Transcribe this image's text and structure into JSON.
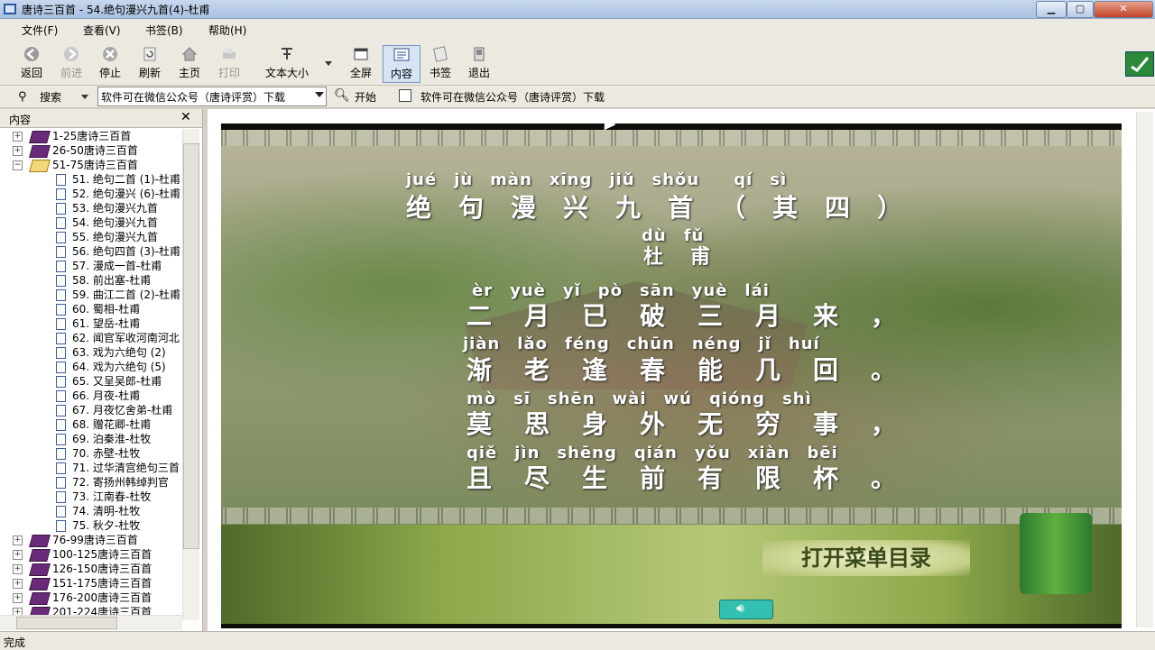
{
  "window": {
    "title": "唐诗三百首 - 54.绝句漫兴九首(4)-杜甫",
    "min_icon": "minimize-icon",
    "max_icon": "maximize-icon",
    "close_icon": "close-icon"
  },
  "menu": [
    "文件(F)",
    "查看(V)",
    "书签(B)",
    "帮助(H)"
  ],
  "toolbar": {
    "back": "返回",
    "forward": "前进",
    "stop": "停止",
    "refresh": "刷新",
    "home": "主页",
    "print": "打印",
    "textsize": "文本大小",
    "fullscreen": "全屏",
    "contents": "内容",
    "bookmark": "书签",
    "exit": "退出"
  },
  "search": {
    "label": "搜索",
    "value": "软件可在微信公众号（唐诗评赏）下载",
    "go": "开始",
    "result": "软件可在微信公众号（唐诗评赏）下载"
  },
  "sidebar": {
    "title": "内容",
    "close": "✕",
    "groups_top": [
      "1-25唐诗三百首",
      "26-50唐诗三百首",
      "51-75唐诗三百首"
    ],
    "leaves": [
      "51. 绝句二首 (1)-杜甫",
      "52. 绝句漫兴 (6)-杜甫",
      "53. 绝句漫兴九首",
      "54. 绝句漫兴九首",
      "55. 绝句漫兴九首",
      "56. 绝句四首 (3)-杜甫",
      "57. 漫成一首-杜甫",
      "58. 前出塞-杜甫",
      "59. 曲江二首 (2)-杜甫",
      "60. 蜀相-杜甫",
      "61. 望岳-杜甫",
      "62. 闻官军收河南河北",
      "63. 戏为六绝句 (2)",
      "64. 戏为六绝句 (5)",
      "65. 又呈吴郎-杜甫",
      "66. 月夜-杜甫",
      "67. 月夜忆舍弟-杜甫",
      "68. 赠花卿-杜甫",
      "69. 泊秦淮-杜牧",
      "70. 赤壁-杜牧",
      "71. 过华清宫绝句三首",
      "72. 寄扬州韩绰判官",
      "73. 江南春-杜牧",
      "74. 清明-杜牧",
      "75. 秋夕-杜牧"
    ],
    "groups_bottom": [
      "76-99唐诗三百首",
      "100-125唐诗三百首",
      "126-150唐诗三百首",
      "151-175唐诗三百首",
      "176-200唐诗三百首",
      "201-224唐诗三百首"
    ]
  },
  "poem": {
    "title_pinyin": "jué　jù　màn　xīng　jiǔ　shǒu　　qí　sì",
    "title": "绝句漫兴九首（其四）",
    "author_pinyin": "dù　fǔ",
    "author": "杜甫",
    "lines": [
      {
        "pinyin": "èr　yuè　yǐ　pò　sān　yuè　lái",
        "text": "二月已破三月来，"
      },
      {
        "pinyin": "jiàn　lǎo　féng　chūn　néng　jǐ　huí",
        "text": "渐老逢春能几回。"
      },
      {
        "pinyin": "mò　sī　shēn　wài　wú　qióng　shì",
        "text": "莫思身外无穷事，"
      },
      {
        "pinyin": "qiě　jìn　shēng　qián　yǒu　xiàn　bēi",
        "text": "且尽生前有限杯。"
      }
    ]
  },
  "open_menu": "打开菜单目录",
  "status": "完成"
}
